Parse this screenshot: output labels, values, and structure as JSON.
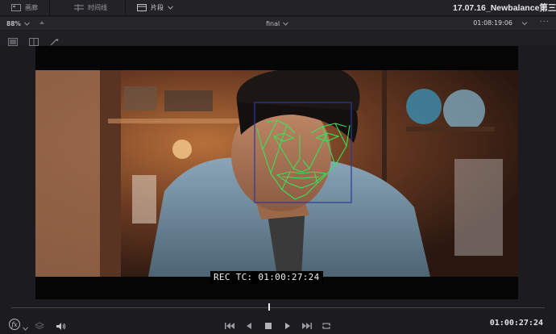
{
  "toolbar": {
    "media_label": "画廊",
    "timeline_label": "时间线",
    "clips_label": "片段"
  },
  "project": {
    "title": "17.07.16_Newbalance第三"
  },
  "viewer_header": {
    "zoom": "88%",
    "clip_name": "final",
    "timecode": "01:08:19:06"
  },
  "viewer": {
    "burn_in_text": "REC TC: 01:00:27:24"
  },
  "transport": {
    "timecode": "01:00:27:24"
  },
  "colors": {
    "tracking_box": "#2a3a9c",
    "face_mesh": "#34e35a",
    "accent": "#e4e4e8"
  },
  "icons": {
    "media": "gallery-icon",
    "timeline": "timeline-icon",
    "clips": "clips-icon",
    "fx": "fx-icon",
    "layers": "layers-icon",
    "volume": "volume-icon"
  }
}
